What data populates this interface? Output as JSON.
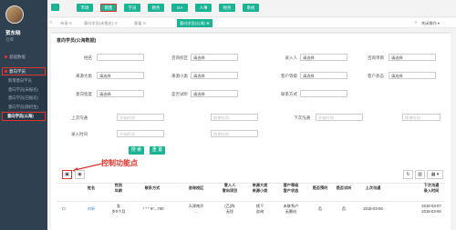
{
  "sidebar": {
    "user_name": "贺东晓",
    "user_role": "仓库",
    "items": [
      {
        "label": "基础数据"
      }
    ],
    "group": {
      "label": "意向学员"
    },
    "sub_items": [
      {
        "label": "新增意向学员"
      },
      {
        "label": "意向学员(未报名)"
      },
      {
        "label": "意向学员(已报名)"
      },
      {
        "label": "意向学员(转招生)"
      },
      {
        "label": "意向学员(公海)"
      }
    ]
  },
  "topbar": {
    "buttons": [
      "市场",
      "销售",
      "学员",
      "教务",
      "OA",
      "人事",
      "财务",
      "系统"
    ],
    "selected": "销售"
  },
  "tabbar": {
    "tabs": [
      {
        "label": "市场 ⊙"
      },
      {
        "label": "意向学员(未报名) ⊙"
      },
      {
        "label": "意看 ⊙"
      },
      {
        "label": "意向学员(公海) ⊗"
      }
    ],
    "right_label": "关闭操作 ▾"
  },
  "panel": {
    "title": "意向学员(公海数据)",
    "filters": {
      "row1": [
        {
          "label": "姓名",
          "value": ""
        },
        {
          "label": "咨询校区",
          "value": "请选择"
        },
        {
          "label": "录入人",
          "value": "请选择"
        },
        {
          "label": "咨询项目",
          "value": "请选择"
        }
      ],
      "row2": [
        {
          "label": "来源大类",
          "value": "请选择"
        },
        {
          "label": "来源小类",
          "value": "请选择"
        },
        {
          "label": "客户等级",
          "value": "请选择"
        },
        {
          "label": "客户状态",
          "value": "请选择"
        }
      ],
      "row3": [
        {
          "label": "意向程度",
          "value": "请选择"
        },
        {
          "label": "是否试听",
          "value": "请选择"
        },
        {
          "label": "联系方式",
          "value": ""
        }
      ],
      "row4": [
        {
          "label": "上次沟通",
          "start": "开始时间",
          "end": "结束时间"
        },
        {
          "label": "下次沟通",
          "start": "开始时间",
          "end": "结束时间"
        }
      ],
      "row5": [
        {
          "label": "录入时间",
          "start": "开始时间",
          "end": "结束时间"
        }
      ]
    },
    "search_label": "搜 索",
    "reset_label": "重 置",
    "annotation": "控制功能点",
    "controls": {
      "left": [
        "▣",
        "◉"
      ],
      "right": [
        "↻",
        "▥",
        "▦ ▾"
      ]
    },
    "table": {
      "headers": [
        "",
        "姓名",
        "性别\n年龄",
        "联系方式",
        "咨询校区",
        "意入人\n意向项目",
        "来源大类\n来源小类",
        "客户等级\n客户状态",
        "是否预约",
        "是否试听",
        "上次沟通",
        "下次沟通\n录入时间"
      ],
      "rows": [
        [
          "☐",
          "刘轩",
          "女\n岁0个月",
          "* * * 6*...760",
          "天津南开\n...",
          "(乙)陈\n无忧",
          "线下\n咨询",
          "未联系户\n无需向",
          "否",
          "否",
          "2018-03-06",
          "2018-03-07\n2018-03-06"
        ]
      ]
    }
  },
  "colors": {
    "sidebar_bg": "#2f4050",
    "accent": "#1ab394",
    "highlight": "#e0322d"
  }
}
